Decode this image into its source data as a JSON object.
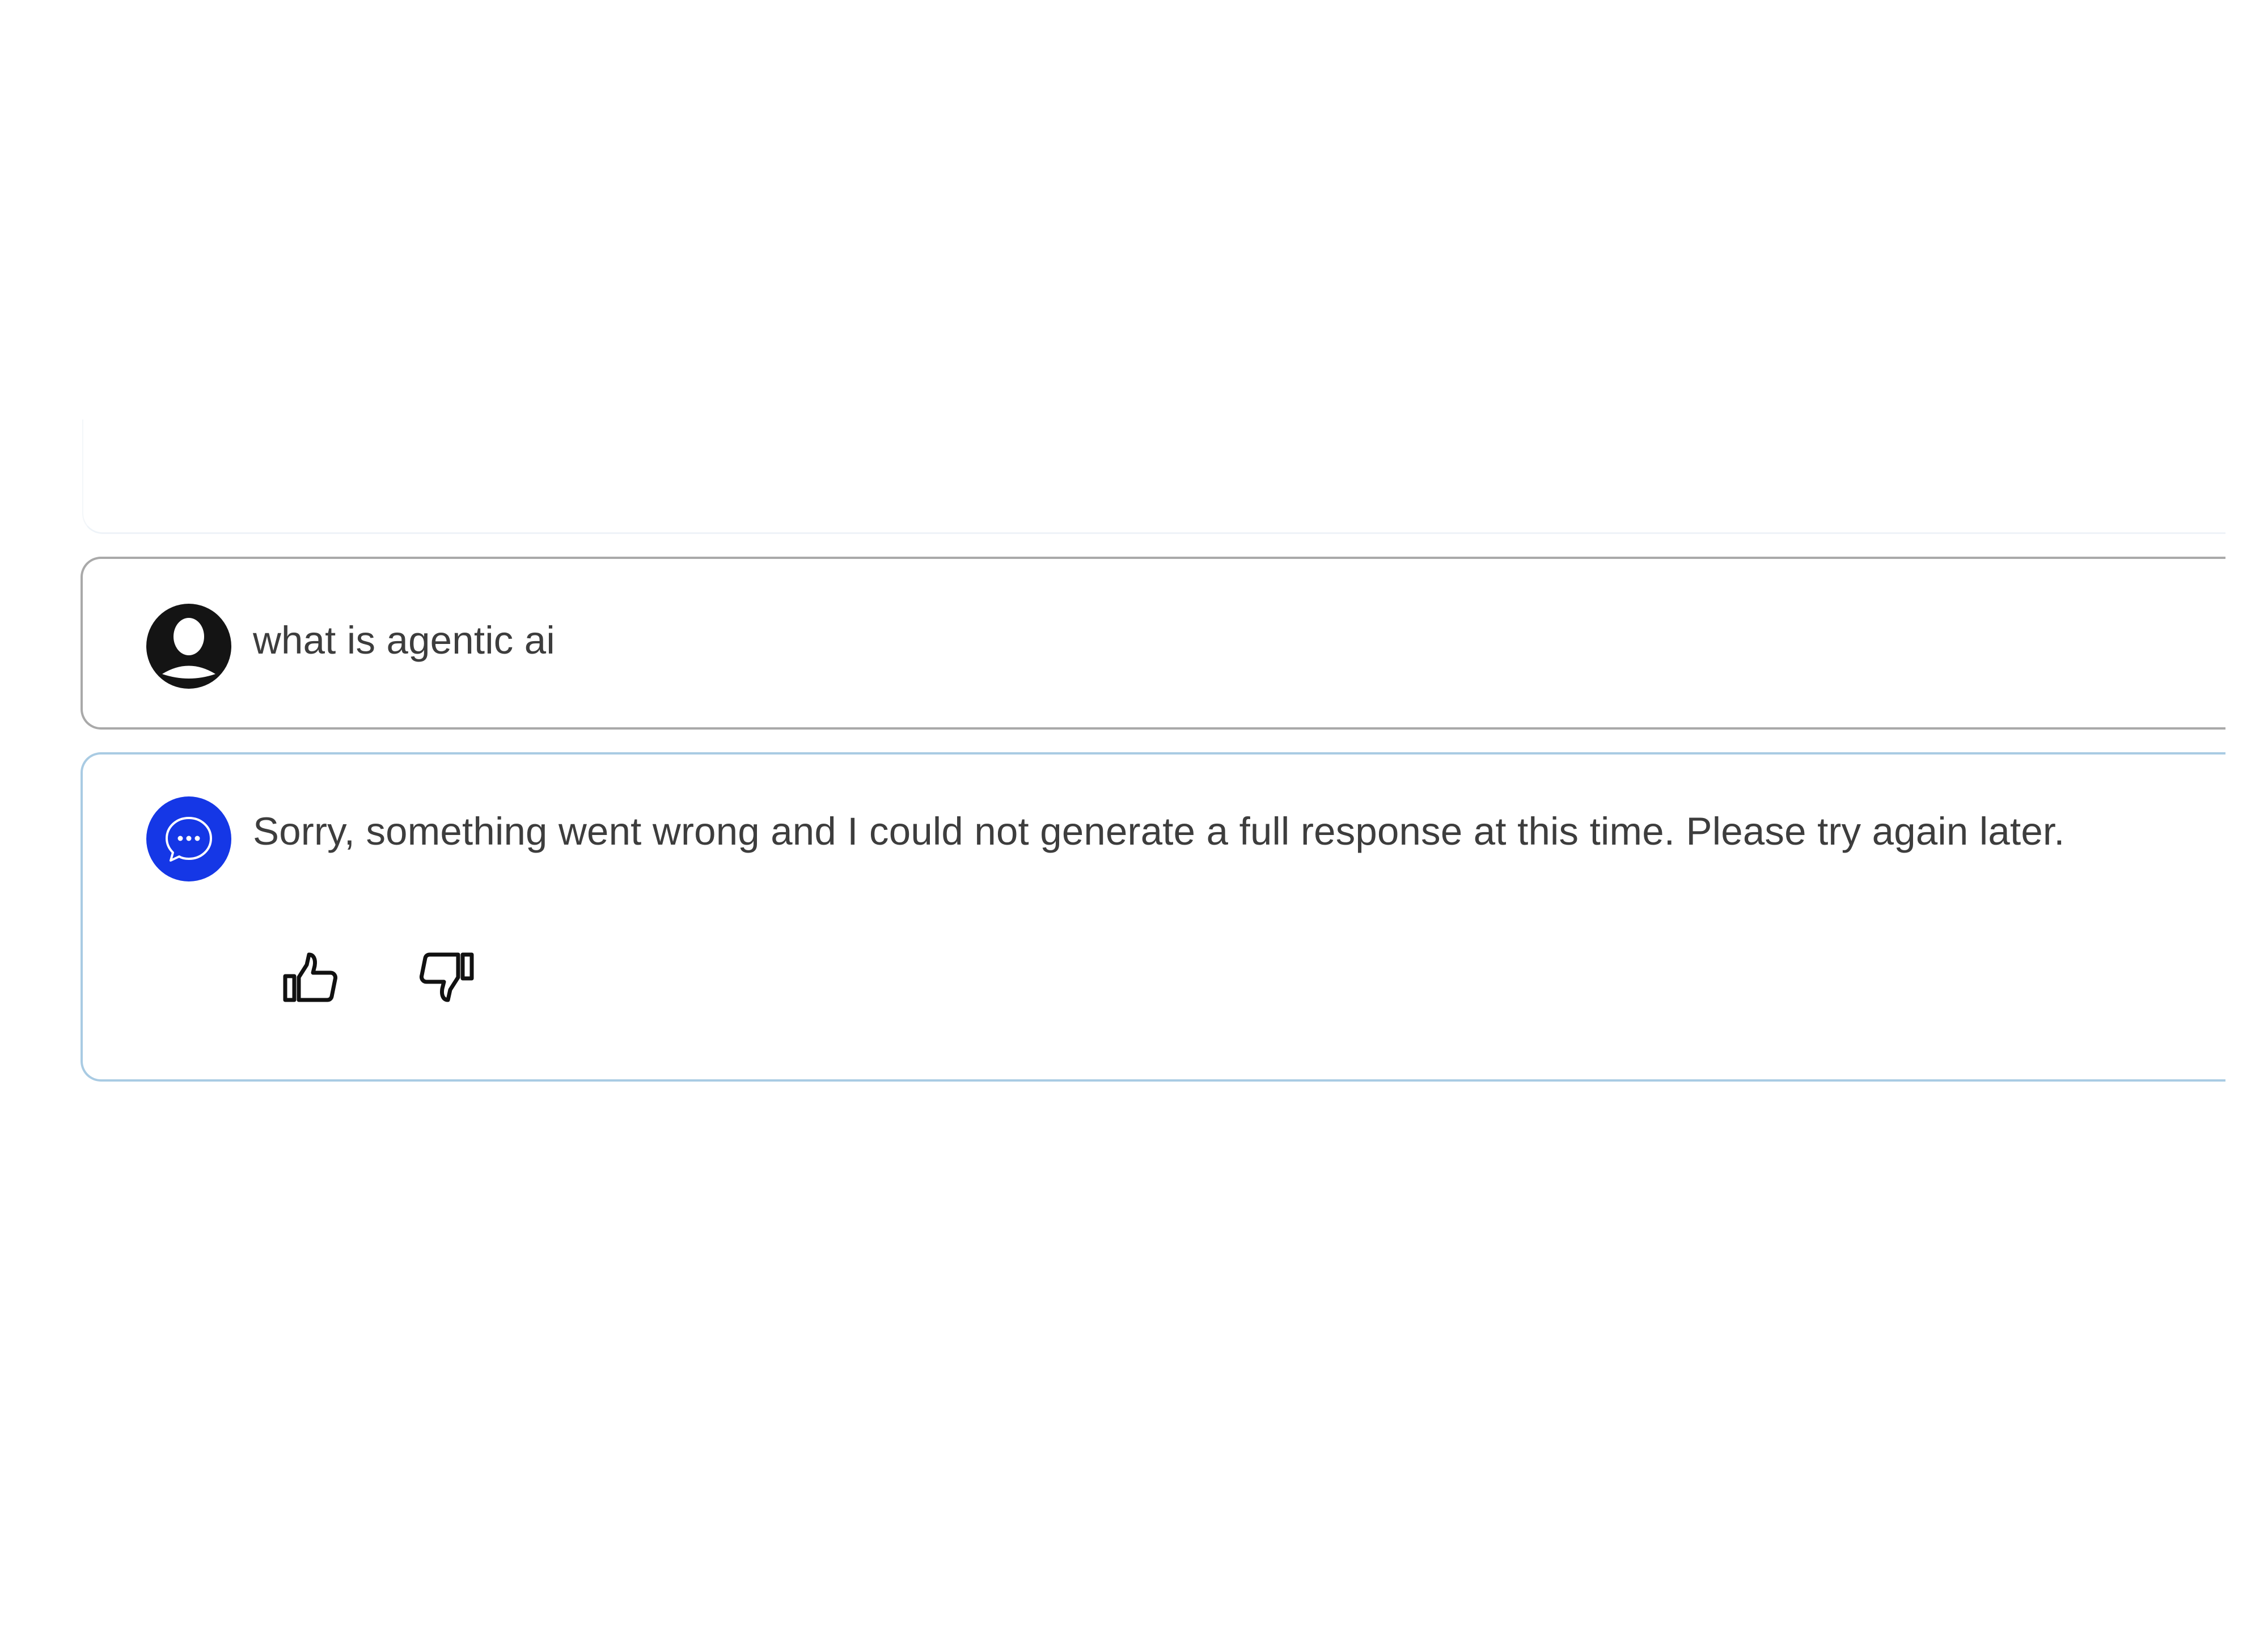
{
  "conversation": {
    "user_message": {
      "text": "what is agentic ai",
      "avatar_icon": "user-avatar-icon"
    },
    "assistant_message": {
      "text": "Sorry, something went wrong and I could not generate a full response at this time. Please try again later.",
      "avatar_icon": "chat-bubble-icon",
      "feedback": {
        "thumbs_up_icon": "thumbs-up-icon",
        "thumbs_down_icon": "thumbs-down-icon"
      }
    }
  },
  "colors": {
    "assistant_avatar": "#1537e6",
    "user_avatar": "#141414",
    "user_card_border": "#a9a9a9",
    "assistant_card_border": "#a9cbe3",
    "text": "#3d3d3d"
  }
}
